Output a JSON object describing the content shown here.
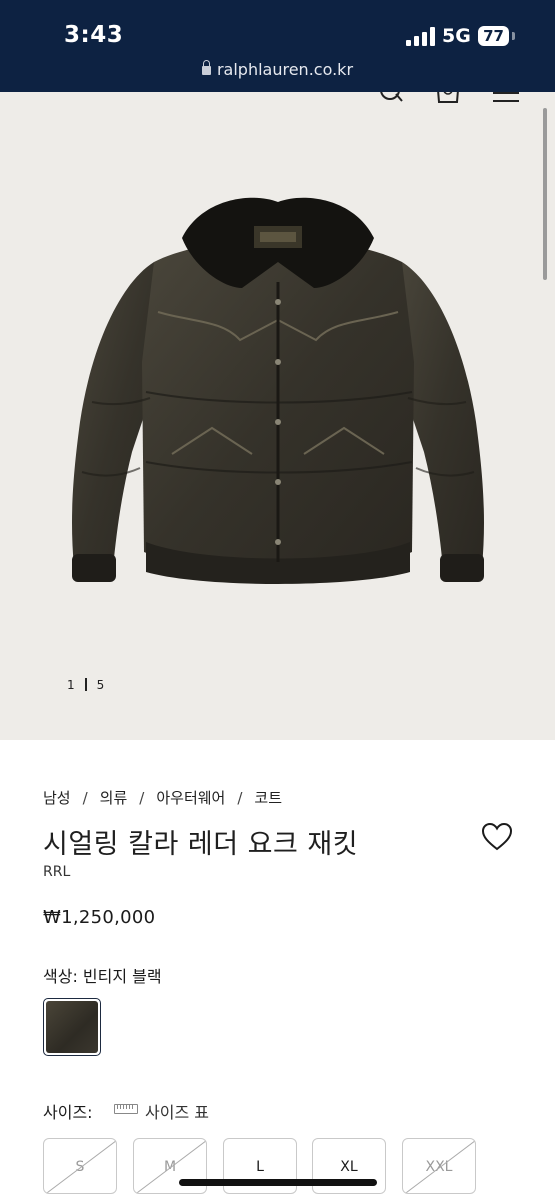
{
  "status_bar": {
    "time": "3:43",
    "network": "5G",
    "battery": "77"
  },
  "browser": {
    "url": "ralphlauren.co.kr"
  },
  "header_icons": [
    "search-icon",
    "shopping-bag-icon",
    "menu-icon"
  ],
  "gallery": {
    "current": "1",
    "total": "5"
  },
  "breadcrumb": [
    "남성",
    "의류",
    "아우터웨어",
    "코트"
  ],
  "product": {
    "title": "시얼링 칼라 레더 요크 재킷",
    "brand": "RRL",
    "price": "₩1,250,000",
    "color_label": "색상: 빈티지 블랙",
    "swatch_color": "#3a362d"
  },
  "sizes": {
    "label": "사이즈:",
    "chart_link": "사이즈 표",
    "options": [
      {
        "label": "S",
        "available": false
      },
      {
        "label": "M",
        "available": false
      },
      {
        "label": "L",
        "available": true
      },
      {
        "label": "XL",
        "available": true
      },
      {
        "label": "XXL",
        "available": false
      }
    ]
  }
}
